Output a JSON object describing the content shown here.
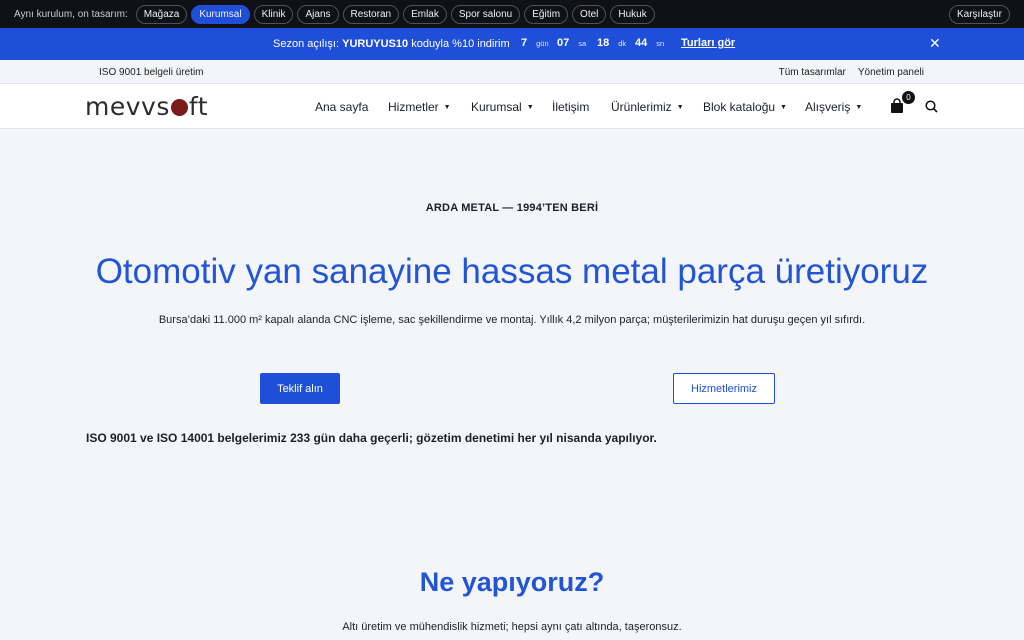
{
  "demo_bar": {
    "label": "Aynı kurulum, on tasarım:",
    "pills": [
      "Mağaza",
      "Kurumsal",
      "Klinik",
      "Ajans",
      "Restoran",
      "Emlak",
      "Spor salonu",
      "Eğitim",
      "Otel",
      "Hukuk"
    ],
    "active": "Kurumsal",
    "compare": "Karşılaştır",
    "colors": {
      "background": "#0f1116",
      "active_pill": "#1f4fd8"
    }
  },
  "promo": {
    "prefix": "Sezon açılışı:",
    "code": "YURUYUS10",
    "suffix": "koduyla %10 indirim",
    "countdown": [
      {
        "value": "7",
        "unit": "gün"
      },
      {
        "value": "07",
        "unit": "sa"
      },
      {
        "value": "18",
        "unit": "dk"
      },
      {
        "value": "44",
        "unit": "sn"
      }
    ],
    "link": "Turları gör",
    "close_icon": "close-icon",
    "color": "#1f4fd8"
  },
  "utility": {
    "left": "ISO 9001 belgeli üretim",
    "links": [
      "Tüm tasarımlar",
      "Yönetim paneli"
    ]
  },
  "header": {
    "logo_pre": "mevvs",
    "logo_post": "ft",
    "nav": [
      {
        "label": "Ana sayfa",
        "dropdown": false
      },
      {
        "label": "Hizmetler",
        "dropdown": true
      },
      {
        "label": "Kurumsal",
        "dropdown": true
      },
      {
        "label": "İletişim",
        "dropdown": false
      },
      {
        "label": "Ürünlerimiz",
        "dropdown": true
      },
      {
        "label": "Blok kataloğu",
        "dropdown": true
      },
      {
        "label": "Alışveriş",
        "dropdown": true
      }
    ],
    "cart_count": "0",
    "icons": [
      "shopping-bag-icon",
      "search-icon"
    ]
  },
  "hero": {
    "eyebrow": "ARDA METAL — 1994’TEN BERİ",
    "title": "Otomotiv yan sanayine hassas metal parça üretiyoruz",
    "subtitle": "Bursa’daki 11.000 m² kapalı alanda CNC işleme, sac şekillendirme ve montaj. Yıllık 4,2 milyon parça; müşterilerimizin hat duruşu geçen yıl sıfırdı.",
    "primary_cta": "Teklif alın",
    "secondary_cta": "Hizmetlerimiz",
    "cert_note": "ISO 9001 ve ISO 14001 belgelerimiz 233 gün daha geçerli; gözetim denetimi her yıl nisanda yapılıyor.",
    "title_color": "#2155d6"
  },
  "section": {
    "title": "Ne yapıyoruz?",
    "subtitle": "Altı üretim ve mühendislik hizmeti; hepsi aynı çatı altında, taşeronsuz."
  }
}
